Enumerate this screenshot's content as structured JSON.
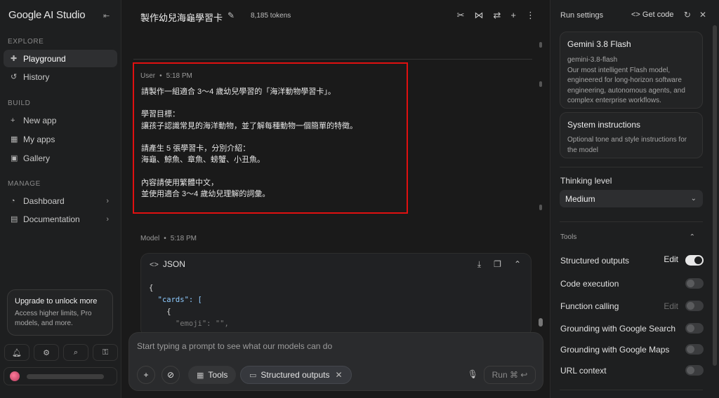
{
  "sidebar": {
    "brand": "Google AI Studio",
    "sections": {
      "explore": "EXPLORE",
      "build": "BUILD",
      "manage": "MANAGE"
    },
    "items": [
      {
        "label": "Playground",
        "icon": "playground-icon"
      },
      {
        "label": "History",
        "icon": "history-icon"
      },
      {
        "label": "New app",
        "icon": "plus-icon"
      },
      {
        "label": "My apps",
        "icon": "apps-icon"
      },
      {
        "label": "Gallery",
        "icon": "gallery-icon"
      },
      {
        "label": "Dashboard",
        "icon": "dashboard-icon"
      },
      {
        "label": "Documentation",
        "icon": "documentation-icon"
      }
    ],
    "upgrade": {
      "title": "Upgrade to unlock more",
      "desc": "Access higher limits, Pro models, and more."
    }
  },
  "header": {
    "title": "製作幼兒海龜學習卡",
    "tokens": "8,185 tokens"
  },
  "chat": {
    "user": {
      "role": "User",
      "time": "5:18 PM",
      "lines": [
        "請製作一組適合 3～4 歲幼兒學習的「海洋動物學習卡」。",
        "學習目標：",
        "讓孩子認識常見的海洋動物，並了解每種動物一個簡單的特徵。",
        "請產生 5 張學習卡，分別介紹：",
        "海龜、鯨魚、章魚、螃蟹、小丑魚。",
        "內容請使用繁體中文，",
        "並使用適合 3～4 歲幼兒理解的詞彙。"
      ]
    },
    "model": {
      "role": "Model",
      "time": "5:18 PM",
      "code_label": "JSON",
      "code_lines": [
        "{",
        "  \"cards\": [",
        "    {",
        "      \"emoji\": \"\","
      ]
    }
  },
  "prompt": {
    "placeholder": "Start typing a prompt to see what our models can do",
    "tools_label": "Tools",
    "structured_label": "Structured outputs",
    "run_label": "Run ⌘ ↩"
  },
  "run_settings": {
    "title": "Run settings",
    "get_code": "<> Get code",
    "model": {
      "name": "Gemini 3.8 Flash",
      "id": "gemini-3.8-flash",
      "desc": "Our most intelligent Flash model, engineered for long-horizon software engineering, autonomous agents, and complex enterprise workflows."
    },
    "system": {
      "title": "System instructions",
      "desc": "Optional tone and style instructions for the model"
    },
    "thinking_label": "Thinking level",
    "thinking_value": "Medium",
    "tools_head": "Tools",
    "tools": [
      {
        "label": "Structured outputs",
        "edit": "Edit",
        "on": true
      },
      {
        "label": "Code execution",
        "edit": "",
        "on": false
      },
      {
        "label": "Function calling",
        "edit": "Edit",
        "on": false
      },
      {
        "label": "Grounding with Google Search",
        "edit": "",
        "on": false
      },
      {
        "label": "Grounding with Google Maps",
        "edit": "",
        "on": false
      },
      {
        "label": "URL context",
        "edit": "",
        "on": false
      }
    ]
  },
  "colors": {
    "highlight": "#e01010",
    "background": "#1a1a1a"
  }
}
